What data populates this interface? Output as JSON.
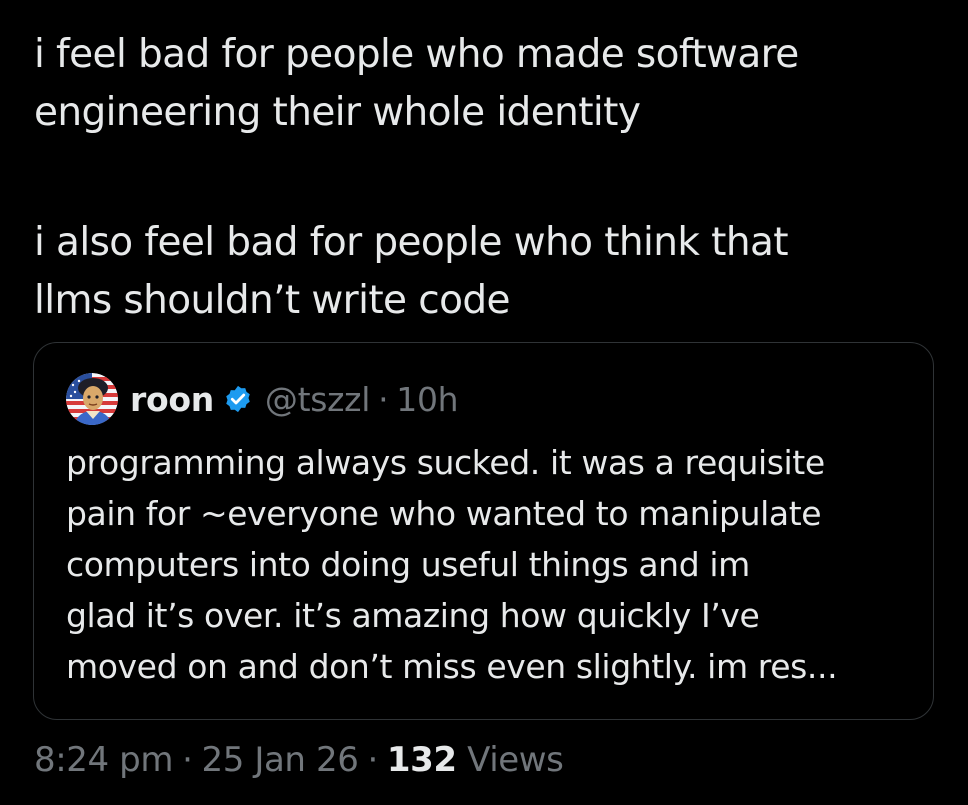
{
  "tweet": {
    "text_lines_p1": [
      "i feel bad for people who made software",
      "engineering their whole identity"
    ],
    "text_lines_p2": [
      "i also feel bad for people who think that",
      "llms shouldn’t write code"
    ],
    "time": "8:24 pm",
    "date": "25 Jan 26",
    "views_count": "132",
    "views_label": "Views",
    "separator": "·"
  },
  "quote": {
    "author_name": "roon",
    "author_handle": "@tszzl",
    "separator": "·",
    "age": "10h",
    "verified_icon": "verified-badge-icon",
    "text_lines": [
      "programming always sucked. it was a requisite",
      "pain for ~everyone who wanted to manipulate",
      "computers into doing useful things and im",
      "glad it’s over. it’s amazing how quickly I’ve",
      "moved on and don’t miss even slightly. im res..."
    ]
  },
  "colors": {
    "background": "#000000",
    "primary_text": "#e7e9ea",
    "secondary_text": "#71767b",
    "card_border": "#2f3336",
    "verified_blue": "#1d9bf0"
  }
}
